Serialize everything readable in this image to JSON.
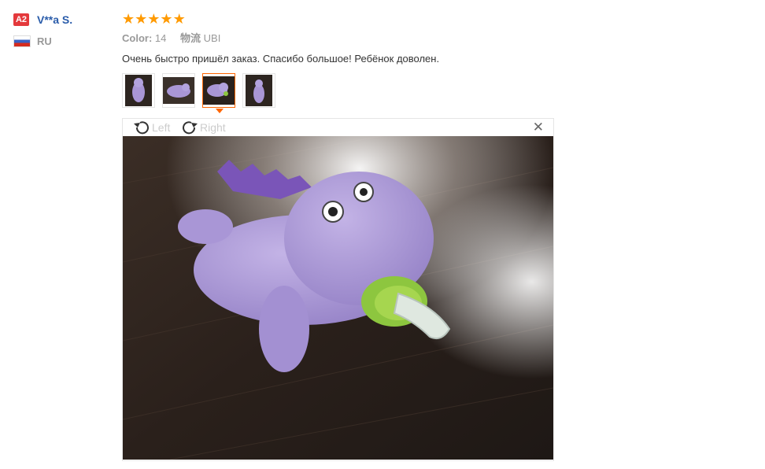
{
  "user": {
    "level": "A2",
    "name": "V**a S.",
    "country": "RU"
  },
  "review": {
    "rating": 5,
    "rating_max": 5,
    "star_color": "#ff9a00",
    "attributes": [
      {
        "key": "Color:",
        "value": "14"
      },
      {
        "key": "物流",
        "value": "UBI"
      }
    ],
    "text": "Очень быстро пришёл заказ. Спасибо большое! Ребёнок доволен.",
    "thumbnails_count": 4,
    "active_thumbnail": 3
  },
  "viewer": {
    "rotate_left": "Left",
    "rotate_right": "Right",
    "close_icon": "close-icon"
  },
  "colors": {
    "accent": "#f60",
    "username": "#2a5caa",
    "badge": "#e4393c"
  }
}
